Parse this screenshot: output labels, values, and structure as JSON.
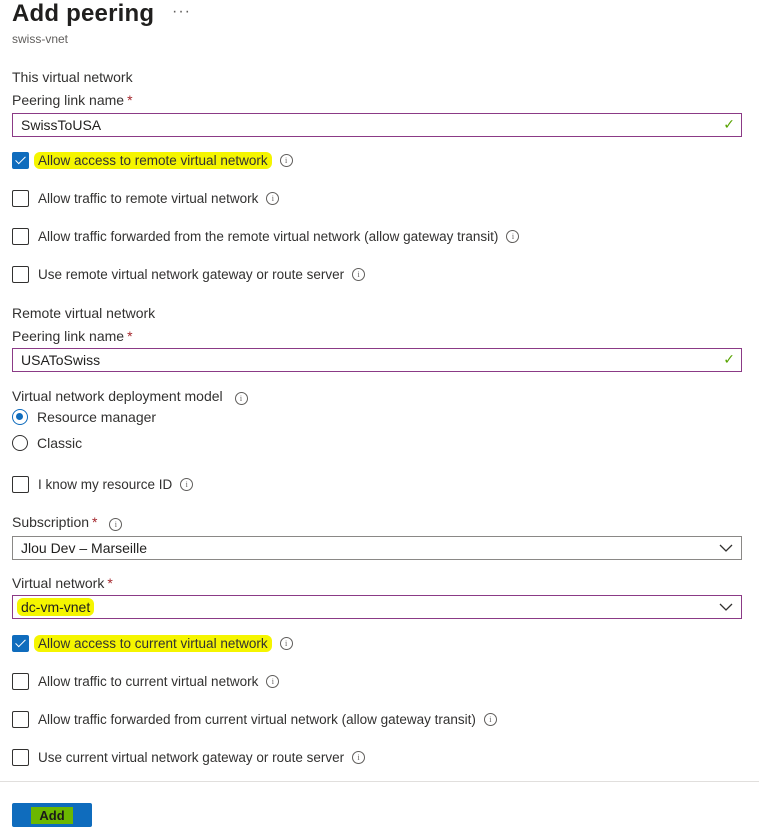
{
  "header": {
    "title": "Add peering",
    "more": "···",
    "subtitle": "swiss-vnet"
  },
  "this_network": {
    "section": "This virtual network",
    "link_name_label": "Peering link name",
    "required": "*",
    "link_name_value": "SwissToUSA",
    "checkboxes": [
      {
        "label": "Allow access to remote virtual network",
        "checked": true
      },
      {
        "label": "Allow traffic to remote virtual network",
        "checked": false
      },
      {
        "label": "Allow traffic forwarded from the remote virtual network (allow gateway transit)",
        "checked": false
      },
      {
        "label": "Use remote virtual network gateway or route server",
        "checked": false
      }
    ]
  },
  "remote_network": {
    "section": "Remote virtual network",
    "link_name_label": "Peering link name",
    "required": "*",
    "link_name_value": "USAToSwiss",
    "deployment_label": "Virtual network deployment model",
    "deployment_options": [
      "Resource manager",
      "Classic"
    ],
    "deployment_selected": "Resource manager",
    "resource_id_label": "I know my resource ID",
    "subscription_label": "Subscription",
    "subscription_value": "Jlou Dev – Marseille",
    "vnet_label": "Virtual network",
    "vnet_value": "dc-vm-vnet",
    "checkboxes": [
      {
        "label": "Allow access to current virtual network",
        "checked": true
      },
      {
        "label": "Allow traffic to current virtual network",
        "checked": false
      },
      {
        "label": "Allow traffic forwarded from current virtual network (allow gateway transit)",
        "checked": false
      },
      {
        "label": "Use current virtual network gateway or route server",
        "checked": false
      }
    ]
  },
  "footer": {
    "add_label": "Add"
  },
  "icons": {
    "info": "info-icon",
    "valid": "checkmark-icon",
    "dropdown": "chevron-down-icon"
  },
  "colors": {
    "accent": "#0f6cbd",
    "highlight": "#f5f500",
    "focus_border": "#8b3a86",
    "valid": "#57a300"
  }
}
